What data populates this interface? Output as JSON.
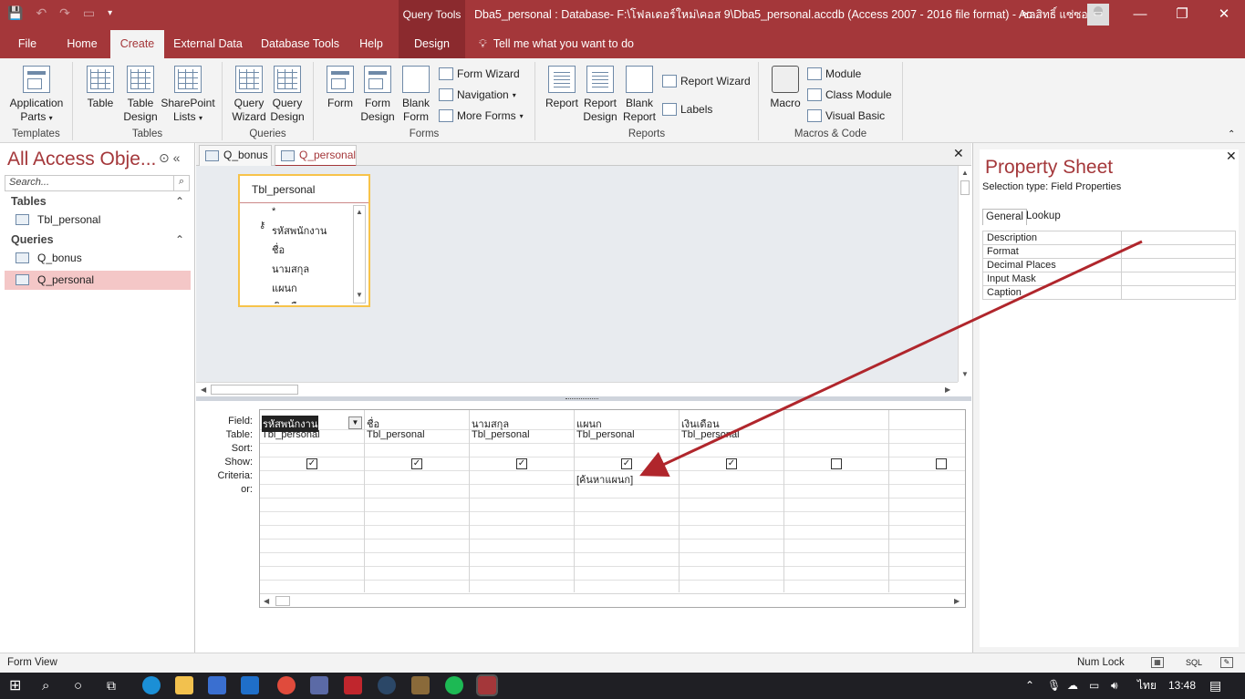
{
  "titlebar": {
    "context_tools": "Query Tools",
    "document_title": "Dba5_personal : Database- F:\\โฟลเดอร์ใหม่\\คอส 9\\Dba5_personal.accdb (Access 2007 - 2016 file format) - Ac...",
    "user_name": "ชลสิทธิ์ แซ่ซอ"
  },
  "tabs": {
    "file": "File",
    "home": "Home",
    "create": "Create",
    "external": "External Data",
    "dbtools": "Database Tools",
    "help": "Help",
    "design": "Design",
    "tellme": "Tell me what you want to do"
  },
  "ribbon": {
    "templates": {
      "label": "Templates",
      "app_parts": "Application",
      "app_parts2": "Parts"
    },
    "tables": {
      "label": "Tables",
      "table": "Table",
      "table_design": "Table",
      "table_design2": "Design",
      "sharepoint": "SharePoint",
      "sharepoint2": "Lists"
    },
    "queries": {
      "label": "Queries",
      "wizard": "Query",
      "wizard2": "Wizard",
      "design": "Query",
      "design2": "Design"
    },
    "forms": {
      "label": "Forms",
      "form": "Form",
      "form_design": "Form",
      "form_design2": "Design",
      "blank_form": "Blank",
      "blank_form2": "Form",
      "form_wizard": "Form Wizard",
      "navigation": "Navigation",
      "more_forms": "More Forms"
    },
    "reports": {
      "label": "Reports",
      "report": "Report",
      "report_design": "Report",
      "report_design2": "Design",
      "blank_report": "Blank",
      "blank_report2": "Report",
      "report_wizard": "Report Wizard",
      "labels": "Labels"
    },
    "macros": {
      "label": "Macros & Code",
      "macro": "Macro",
      "module": "Module",
      "class_module": "Class Module",
      "visual_basic": "Visual Basic"
    }
  },
  "nav": {
    "title": "All Access Obje...",
    "search_placeholder": "Search...",
    "groups": [
      {
        "label": "Tables",
        "items": [
          "Tbl_personal"
        ]
      },
      {
        "label": "Queries",
        "items": [
          "Q_bonus",
          "Q_personal"
        ]
      }
    ]
  },
  "doc_tabs": [
    "Q_bonus",
    "Q_personal"
  ],
  "table_box": {
    "title": "Tbl_personal",
    "fields": [
      "*",
      "รหัสพนักงาน",
      "ชื่อ",
      "นามสกุล",
      "แผนก",
      "เงินเดือน"
    ]
  },
  "qbe": {
    "row_labels": [
      "Field:",
      "Table:",
      "Sort:",
      "Show:",
      "Criteria:",
      "or:"
    ],
    "columns": [
      {
        "field": "รหัสพนักงาน",
        "table": "Tbl_personal",
        "show": true,
        "criteria": ""
      },
      {
        "field": "ชื่อ",
        "table": "Tbl_personal",
        "show": true,
        "criteria": ""
      },
      {
        "field": "นามสกุล",
        "table": "Tbl_personal",
        "show": true,
        "criteria": ""
      },
      {
        "field": "แผนก",
        "table": "Tbl_personal",
        "show": true,
        "criteria": "[ค้นหาแผนก]"
      },
      {
        "field": "เงินเดือน",
        "table": "Tbl_personal",
        "show": true,
        "criteria": ""
      },
      {
        "field": "",
        "table": "",
        "show": false,
        "criteria": ""
      },
      {
        "field": "",
        "table": "",
        "show": false,
        "criteria": ""
      }
    ]
  },
  "property_sheet": {
    "title": "Property Sheet",
    "selection_type": "Selection type:  Field Properties",
    "tabs": [
      "General",
      "Lookup"
    ],
    "rows": [
      "Description",
      "Format",
      "Decimal Places",
      "Input Mask",
      "Caption"
    ]
  },
  "status": {
    "left": "Form View",
    "numlock": "Num Lock",
    "sql": "SQL"
  },
  "taskbar": {
    "lang": "ไทย",
    "time": "13:48"
  },
  "colors": {
    "accent": "#a4373a",
    "arrow": "#b0262c"
  }
}
